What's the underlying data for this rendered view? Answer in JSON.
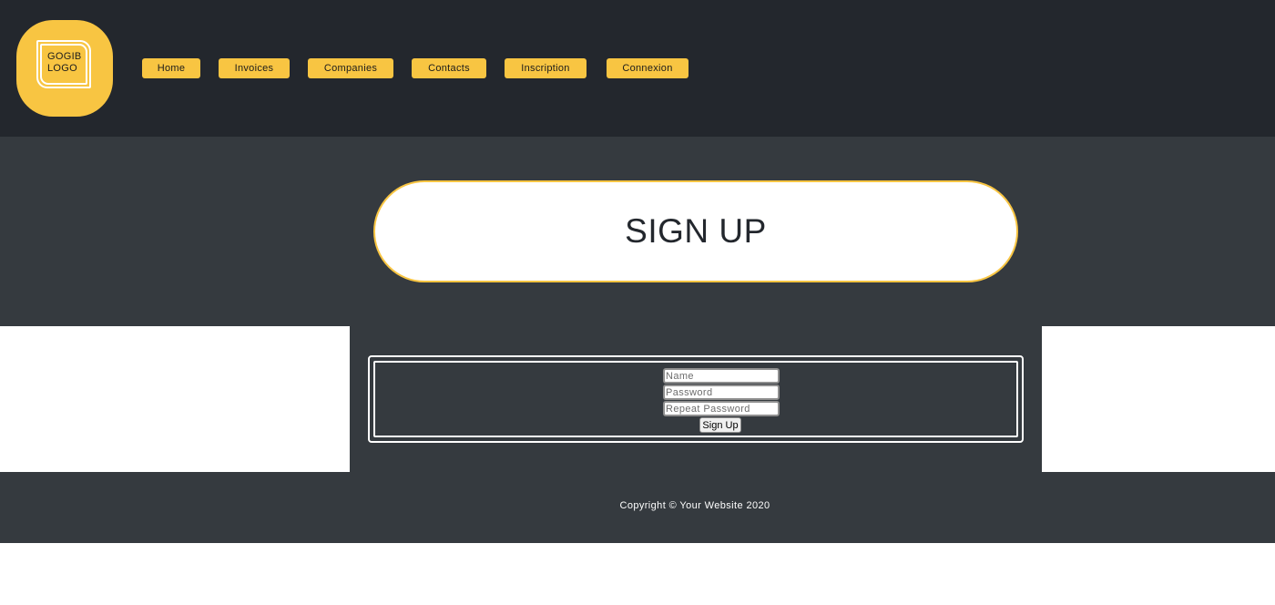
{
  "header": {
    "logo_line1": "GOGIB",
    "logo_line2": "LOGO",
    "nav": [
      "Home",
      "Invoices",
      "Companies",
      "Contacts",
      "Inscription",
      "Connexion"
    ]
  },
  "hero": {
    "title": "SIGN UP"
  },
  "form": {
    "name_placeholder": "Name",
    "password_placeholder": "Password",
    "repeat_password_placeholder": "Repeat Password",
    "submit_label": "Sign Up"
  },
  "footer": {
    "copyright": "Copyright © Your Website 2020"
  },
  "colors": {
    "accent": "#f8c542",
    "header_bg": "#23272d",
    "band_bg": "#353a3f"
  }
}
